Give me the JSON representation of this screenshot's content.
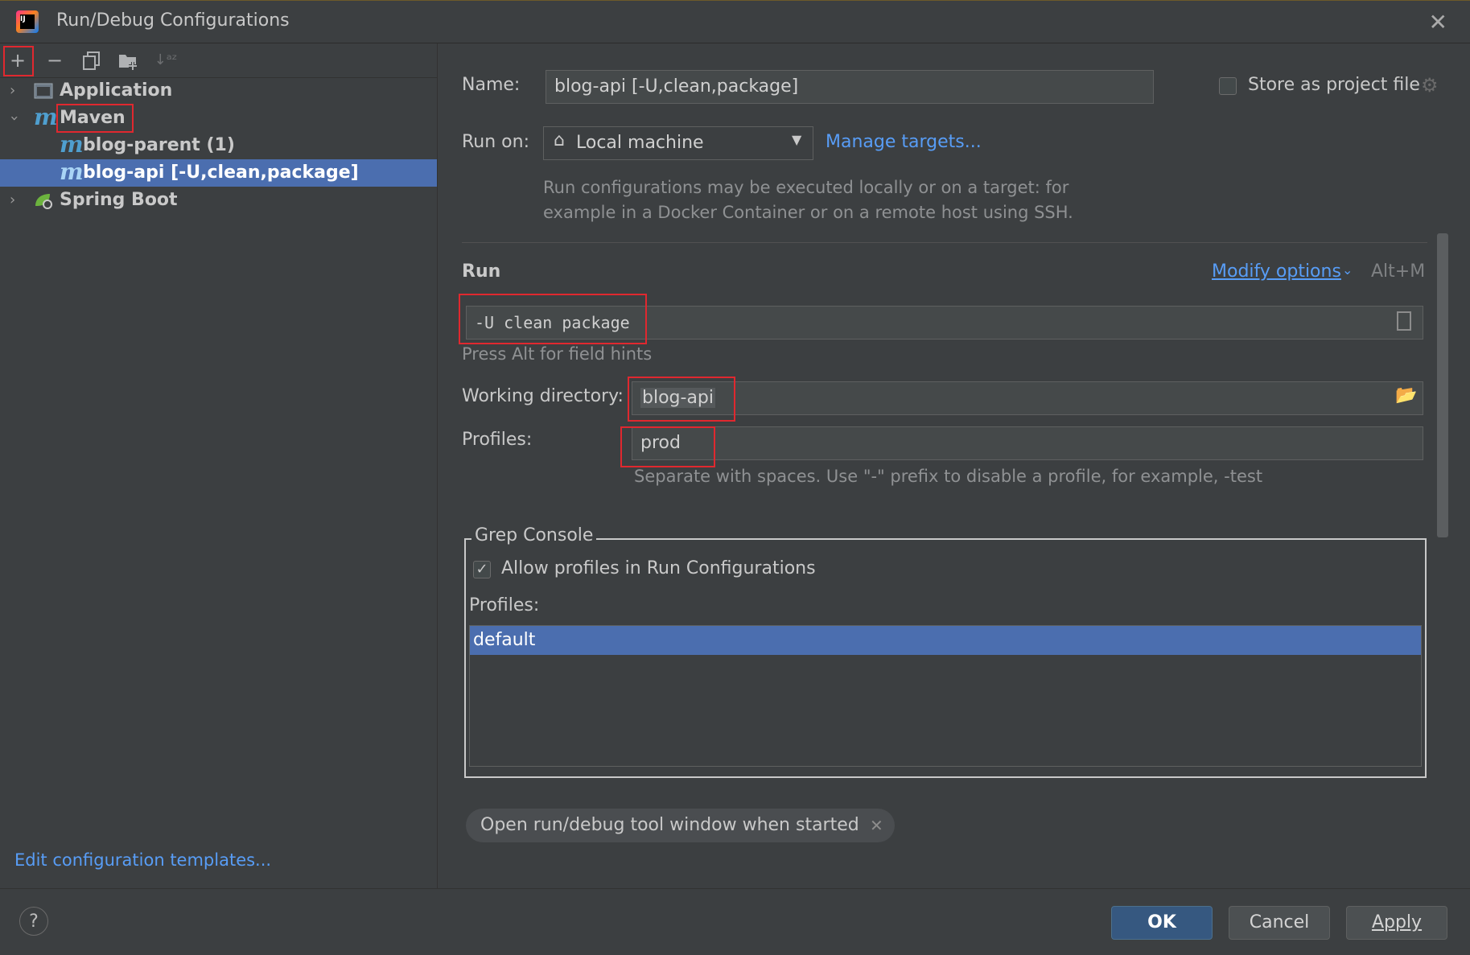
{
  "window": {
    "title": "Run/Debug Configurations"
  },
  "toolbar": {
    "add": "+",
    "remove": "−"
  },
  "tree": {
    "application": "Application",
    "maven": "Maven",
    "maven_children": [
      "blog-parent (1)",
      "blog-api [-U,clean,package]"
    ],
    "spring_boot": "Spring Boot"
  },
  "left_footer": {
    "edit_templates": "Edit configuration templates..."
  },
  "form": {
    "name_label": "Name:",
    "name_value": "blog-api [-U,clean,package]",
    "store_label": "Store as project file",
    "run_on_label": "Run on:",
    "run_on_value": "Local machine",
    "manage_targets": "Manage targets...",
    "run_on_hint_1": "Run configurations may be executed locally or on a target: for",
    "run_on_hint_2": "example in a Docker Container or on a remote host using SSH.",
    "run_section": "Run",
    "modify_options": "Modify options",
    "modify_shortcut": "Alt+M",
    "command_value": "-U clean package",
    "press_alt_hint": "Press Alt for field hints",
    "working_dir_label": "Working directory:",
    "working_dir_value": "blog-api",
    "profiles_label": "Profiles:",
    "profiles_value": "prod",
    "profiles_hint": "Separate with spaces. Use \"-\" prefix to disable a profile, for example, -test"
  },
  "grep_console": {
    "title": "Grep Console",
    "allow_profiles": "Allow profiles in Run Configurations",
    "profiles_label": "Profiles:",
    "profiles": [
      "default"
    ]
  },
  "chip": {
    "label": "Open run/debug tool window when started"
  },
  "footer": {
    "help": "?",
    "ok": "OK",
    "cancel": "Cancel",
    "apply": "Apply"
  }
}
